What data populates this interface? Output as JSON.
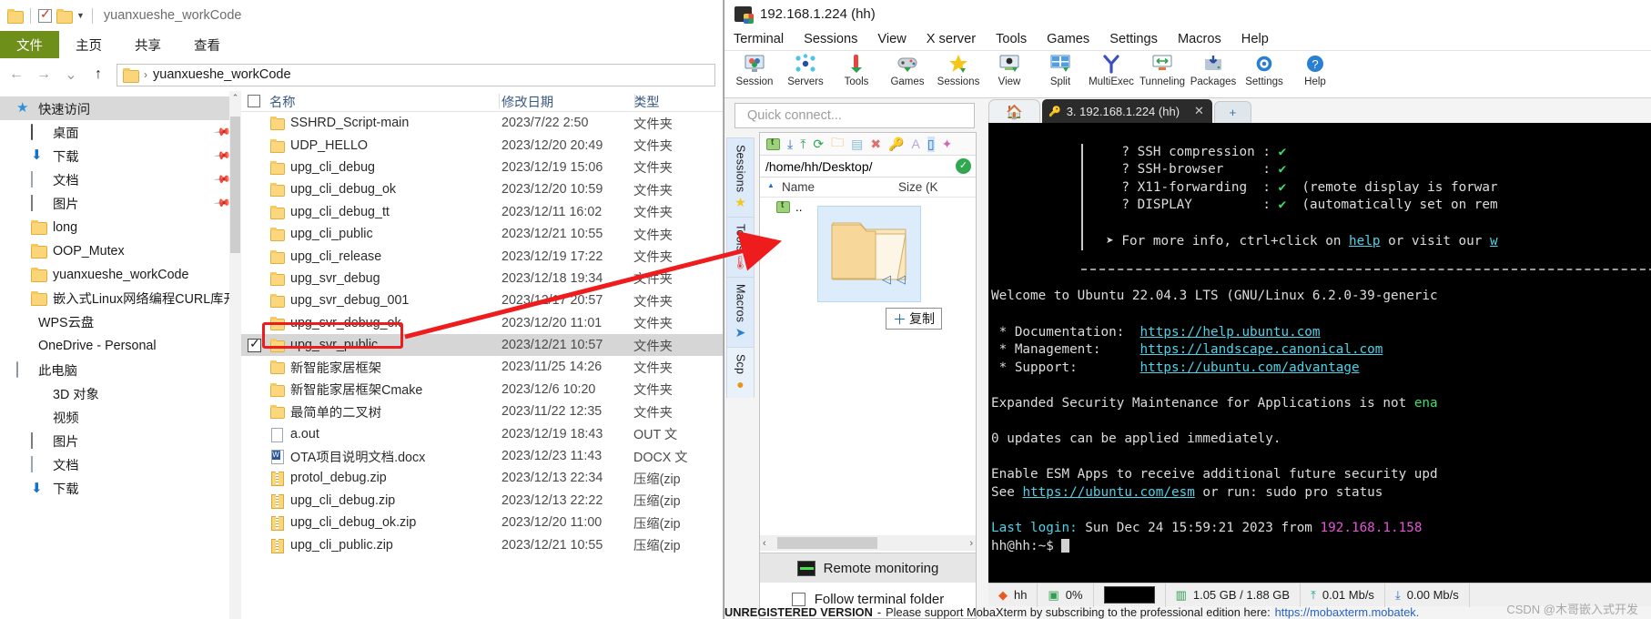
{
  "explorer": {
    "titlebar": {
      "title": "yuanxueshe_workCode"
    },
    "ribbon": {
      "tabs": [
        "文件",
        "主页",
        "共享",
        "查看"
      ]
    },
    "address": {
      "path": "yuanxueshe_workCode"
    },
    "sidebar": [
      {
        "label": "快速访问",
        "icon": "star-icon",
        "indent": 0,
        "selected": true,
        "pin": false
      },
      {
        "label": "桌面",
        "icon": "desktop-icon",
        "indent": 1,
        "selected": false,
        "pin": true
      },
      {
        "label": "下载",
        "icon": "download-icon",
        "indent": 1,
        "selected": false,
        "pin": true
      },
      {
        "label": "文档",
        "icon": "document-icon",
        "indent": 1,
        "selected": false,
        "pin": true
      },
      {
        "label": "图片",
        "icon": "pictures-icon",
        "indent": 1,
        "selected": false,
        "pin": true
      },
      {
        "label": "long",
        "icon": "folder-icon",
        "indent": 1,
        "selected": false,
        "pin": false
      },
      {
        "label": "OOP_Mutex",
        "icon": "folder-icon",
        "indent": 1,
        "selected": false,
        "pin": false
      },
      {
        "label": "yuanxueshe_workCode",
        "icon": "folder-icon",
        "indent": 1,
        "selected": false,
        "pin": false
      },
      {
        "label": "嵌入式Linux网络编程CURL库开发",
        "icon": "folder-icon",
        "indent": 1,
        "selected": false,
        "pin": false
      },
      {
        "label": "WPS云盘",
        "icon": "wps-cloud-icon",
        "indent": 0,
        "selected": false,
        "pin": false
      },
      {
        "label": "OneDrive - Personal",
        "icon": "onedrive-icon",
        "indent": 0,
        "selected": false,
        "pin": false
      },
      {
        "label": "此电脑",
        "icon": "this-pc-icon",
        "indent": 0,
        "selected": false,
        "pin": false
      },
      {
        "label": "3D 对象",
        "icon": "3d-objects-icon",
        "indent": 1,
        "selected": false,
        "pin": false
      },
      {
        "label": "视频",
        "icon": "videos-icon",
        "indent": 1,
        "selected": false,
        "pin": false
      },
      {
        "label": "图片",
        "icon": "pictures-icon",
        "indent": 1,
        "selected": false,
        "pin": false
      },
      {
        "label": "文档",
        "icon": "document-icon",
        "indent": 1,
        "selected": false,
        "pin": false
      },
      {
        "label": "下载",
        "icon": "download-icon",
        "indent": 1,
        "selected": false,
        "pin": false
      }
    ],
    "list": {
      "columns": [
        "名称",
        "修改日期",
        "类型"
      ],
      "rows": [
        {
          "name": "SSHRD_Script-main",
          "date": "2023/7/22 2:50",
          "type": "文件夹",
          "icon": "folder-icon",
          "selected": false,
          "checked": false
        },
        {
          "name": "UDP_HELLO",
          "date": "2023/12/20 20:49",
          "type": "文件夹",
          "icon": "folder-icon",
          "selected": false,
          "checked": false
        },
        {
          "name": "upg_cli_debug",
          "date": "2023/12/19 15:06",
          "type": "文件夹",
          "icon": "folder-icon",
          "selected": false,
          "checked": false
        },
        {
          "name": "upg_cli_debug_ok",
          "date": "2023/12/20 10:59",
          "type": "文件夹",
          "icon": "folder-icon",
          "selected": false,
          "checked": false
        },
        {
          "name": "upg_cli_debug_tt",
          "date": "2023/12/11 16:02",
          "type": "文件夹",
          "icon": "folder-icon",
          "selected": false,
          "checked": false
        },
        {
          "name": "upg_cli_public",
          "date": "2023/12/21 10:55",
          "type": "文件夹",
          "icon": "folder-icon",
          "selected": false,
          "checked": false
        },
        {
          "name": "upg_cli_release",
          "date": "2023/12/19 17:22",
          "type": "文件夹",
          "icon": "folder-icon",
          "selected": false,
          "checked": false
        },
        {
          "name": "upg_svr_debug",
          "date": "2023/12/18 19:34",
          "type": "文件夹",
          "icon": "folder-icon",
          "selected": false,
          "checked": false
        },
        {
          "name": "upg_svr_debug_001",
          "date": "2023/12/17 20:57",
          "type": "文件夹",
          "icon": "folder-icon",
          "selected": false,
          "checked": false
        },
        {
          "name": "upg_svr_debug_ok",
          "date": "2023/12/20 11:01",
          "type": "文件夹",
          "icon": "folder-icon",
          "selected": false,
          "checked": false
        },
        {
          "name": "upg_svr_public",
          "date": "2023/12/21 10:57",
          "type": "文件夹",
          "icon": "folder-icon",
          "selected": true,
          "checked": true
        },
        {
          "name": "新智能家居框架",
          "date": "2023/11/25 14:26",
          "type": "文件夹",
          "icon": "folder-icon",
          "selected": false,
          "checked": false
        },
        {
          "name": "新智能家居框架Cmake",
          "date": "2023/12/6 10:20",
          "type": "文件夹",
          "icon": "folder-icon",
          "selected": false,
          "checked": false
        },
        {
          "name": "最简单的二叉树",
          "date": "2023/11/22 12:35",
          "type": "文件夹",
          "icon": "folder-icon",
          "selected": false,
          "checked": false
        },
        {
          "name": "a.out",
          "date": "2023/12/19 18:43",
          "type": "OUT 文",
          "icon": "file-icon",
          "selected": false,
          "checked": false
        },
        {
          "name": "OTA项目说明文档.docx",
          "date": "2023/12/23 11:43",
          "type": "DOCX 文",
          "icon": "word-icon",
          "selected": false,
          "checked": false
        },
        {
          "name": "protol_debug.zip",
          "date": "2023/12/13 22:34",
          "type": "压缩(zip",
          "icon": "zip-icon",
          "selected": false,
          "checked": false
        },
        {
          "name": "upg_cli_debug.zip",
          "date": "2023/12/13 22:22",
          "type": "压缩(zip",
          "icon": "zip-icon",
          "selected": false,
          "checked": false
        },
        {
          "name": "upg_cli_debug_ok.zip",
          "date": "2023/12/20 11:00",
          "type": "压缩(zip",
          "icon": "zip-icon",
          "selected": false,
          "checked": false
        },
        {
          "name": "upg_cli_public.zip",
          "date": "2023/12/21 10:55",
          "type": "压缩(zip",
          "icon": "zip-icon",
          "selected": false,
          "checked": false
        }
      ]
    }
  },
  "mobaxterm": {
    "title": "192.168.1.224 (hh)",
    "menu": [
      "Terminal",
      "Sessions",
      "View",
      "X server",
      "Tools",
      "Games",
      "Settings",
      "Macros",
      "Help"
    ],
    "toolbar": [
      {
        "label": "Session",
        "icon": "session-icon"
      },
      {
        "label": "Servers",
        "icon": "servers-icon"
      },
      {
        "label": "Tools",
        "icon": "tools-icon"
      },
      {
        "label": "Games",
        "icon": "gamepad-icon"
      },
      {
        "label": "Sessions",
        "icon": "star-icon"
      },
      {
        "label": "View",
        "icon": "view-icon"
      },
      {
        "label": "Split",
        "icon": "split-icon"
      },
      {
        "label": "MultiExec",
        "icon": "multiexec-icon"
      },
      {
        "label": "Tunneling",
        "icon": "tunneling-icon"
      },
      {
        "label": "Packages",
        "icon": "packages-icon"
      },
      {
        "label": "Settings",
        "icon": "gear-icon"
      },
      {
        "label": "Help",
        "icon": "help-icon"
      }
    ],
    "quick_connect": {
      "placeholder": "Quick connect..."
    },
    "side_tabs": [
      {
        "label": "Sessions",
        "icon": "star-icon"
      },
      {
        "label": "Tools",
        "icon": "thermometer-icon"
      },
      {
        "label": "Macros",
        "icon": "paperplane-icon"
      },
      {
        "label": "Scp",
        "icon": "globe-icon"
      }
    ],
    "sftp": {
      "path": "/home/hh/Desktop/",
      "columns": [
        "Name",
        "Size (K"
      ],
      "parent_row": "..",
      "drag_badge": "复制",
      "drag_badge_plus": "＋"
    },
    "remote_monitoring": {
      "label": "Remote monitoring"
    },
    "follow_terminal": {
      "label": "Follow terminal folder",
      "checked": false
    },
    "terminal": {
      "home_tab": "home-icon",
      "tab_label": "3. 192.168.1.224 (hh)",
      "new_tab": "+",
      "lines": [
        "    ? SSH compression : ✔",
        "    ? SSH-browser     : ✔",
        "    ? X11-forwarding  : ✔  (remote display is forwar",
        "    ? DISPLAY         : ✔  (automatically set on rem",
        "",
        "  ➤ For more info, ctrl+click on help or visit our w",
        "",
        "Welcome to Ubuntu 22.04.3 LTS (GNU/Linux 6.2.0-39-generic",
        "",
        " * Documentation:  https://help.ubuntu.com",
        " * Management:     https://landscape.canonical.com",
        " * Support:        https://ubuntu.com/advantage",
        "",
        "Expanded Security Maintenance for Applications is not ena",
        "",
        "0 updates can be applied immediately.",
        "",
        "Enable ESM Apps to receive additional future security upd",
        "See https://ubuntu.com/esm or run: sudo pro status",
        "",
        "Last login: Sun Dec 24 15:59:21 2023 from 192.168.1.158",
        "hh@hh:~$ "
      ],
      "box_lines": [
        {
          "label": "? SSH compression",
          "value": "✔",
          "note": ""
        },
        {
          "label": "? SSH-browser",
          "value": "✔",
          "note": ""
        },
        {
          "label": "? X11-forwarding",
          "value": "✔",
          "note": "(remote display is forwar"
        },
        {
          "label": "? DISPLAY",
          "value": "✔",
          "note": "(automatically set on rem"
        }
      ],
      "info_line": {
        "pre": "➤ For more info, ctrl+click on ",
        "link1": "info",
        "mid": " or visit our ",
        "link2": "help",
        "end": "w"
      },
      "welcome": "Welcome to Ubuntu 22.04.3 LTS (GNU/Linux 6.2.0-39-generic",
      "links": [
        {
          "label": " * Documentation: ",
          "url": "https://help.ubuntu.com"
        },
        {
          "label": " * Management:    ",
          "url": "https://landscape.canonical.com"
        },
        {
          "label": " * Support:       ",
          "url": "https://ubuntu.com/advantage"
        }
      ],
      "esm1": "Expanded Security Maintenance for Applications is not ",
      "esm1_green": "ena",
      "updates": "0 updates can be applied immediately.",
      "esm2": "Enable ESM Apps to receive additional future security upd",
      "esm3_pre": "See ",
      "esm3_url": "https://ubuntu.com/esm",
      "esm3_post": " or run: sudo pro status",
      "lastlogin_label": "Last login:",
      "lastlogin_rest": " Sun Dec 24 15:59:21 2023 from ",
      "lastlogin_ip": "192.168.1.158",
      "prompt": "hh@hh:~$ "
    },
    "status": [
      {
        "icon": "user-icon",
        "label": "hh"
      },
      {
        "icon": "cpu-icon",
        "label": "0%"
      },
      {
        "icon": "graph-icon",
        "label": ""
      },
      {
        "icon": "memory-icon",
        "label": "1.05 GB / 1.88 GB"
      },
      {
        "icon": "upload-icon",
        "label": "0.01 Mb/s"
      },
      {
        "icon": "download-icon",
        "label": "0.00 Mb/s"
      }
    ],
    "footer": {
      "unregistered": "UNREGISTERED VERSION",
      "dash": "-",
      "message": "Please support MobaXterm by subscribing to the professional edition here:",
      "link": "https://mobaxterm.mobatek."
    },
    "watermark": "CSDN @木哥嵌入式开发"
  },
  "annotation": {
    "accent": "#ee1c1c"
  }
}
